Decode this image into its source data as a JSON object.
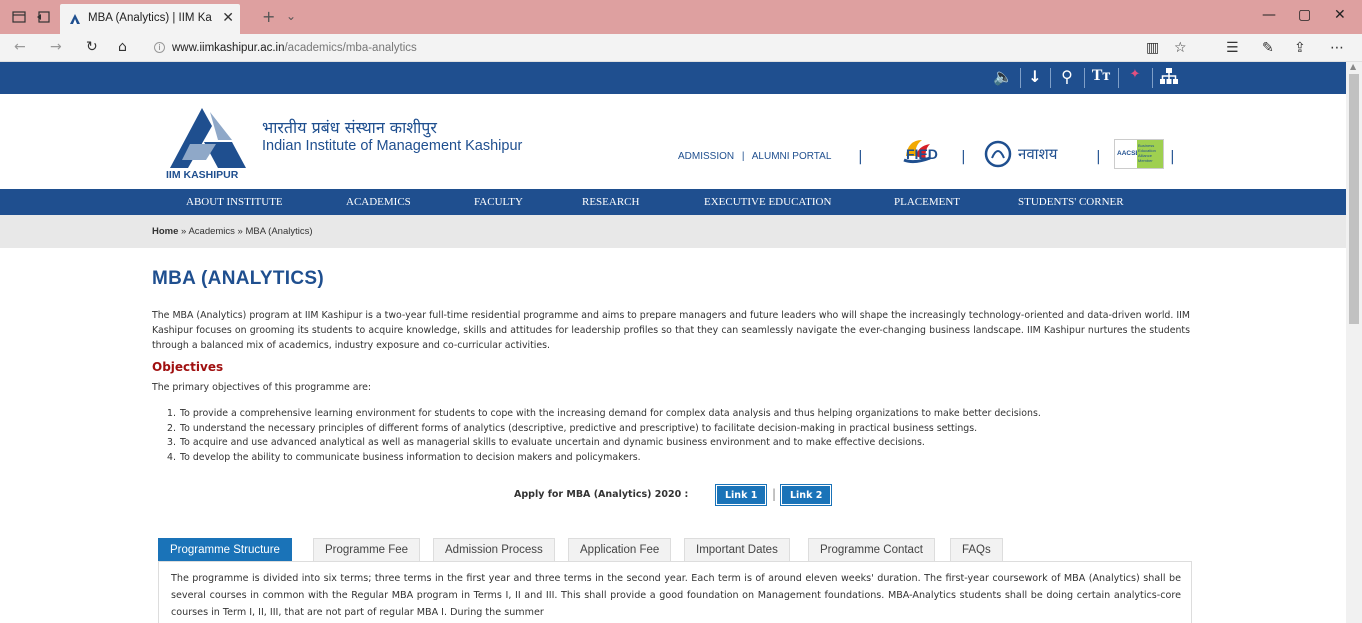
{
  "browser": {
    "tab_title": "MBA (Analytics) | IIM Ka",
    "url_domain": "www.iimkashipur.ac.in",
    "url_path": "/academics/mba-analytics"
  },
  "site": {
    "logo_text": "IIM KASHIPUR",
    "name_hindi": "भारतीय प्रबंध संस्थान काशीपुर",
    "name_english": "Indian Institute of Management Kashipur",
    "header_links": [
      "ADMISSION",
      "ALUMNI PORTAL"
    ],
    "fied_label": "FIED",
    "navodaya_label": "नवाशय",
    "aacsb_label": "AACSB",
    "aacsb_sub": "Business Education Alliance Member"
  },
  "nav": [
    "ABOUT INSTITUTE",
    "ACADEMICS",
    "FACULTY",
    "RESEARCH",
    "EXECUTIVE EDUCATION",
    "PLACEMENT",
    "STUDENTS' CORNER"
  ],
  "breadcrumb": {
    "home": "Home",
    "rest": " » Academics » MBA (Analytics)"
  },
  "page": {
    "title": "MBA (ANALYTICS)",
    "intro": "The MBA (Analytics) program at IIM Kashipur is a two-year full-time residential programme and aims to prepare managers and future leaders who will shape the increasingly technology-oriented and data-driven world. IIM Kashipur focuses on grooming its students to acquire knowledge, skills and attitudes for leadership profiles so that they can seamlessly navigate the ever-changing business landscape. IIM Kashipur nurtures the students through a balanced mix of academics, industry exposure and co-curricular activities.",
    "objectives_heading": "Objectives",
    "objectives_intro": "The primary objectives of this programme are:",
    "objectives": [
      "To provide a comprehensive learning environment for students to cope with the increasing demand for complex data analysis and thus helping organizations to make better decisions.",
      "To understand the necessary principles of different forms of analytics (descriptive, predictive and prescriptive) to facilitate decision-making in practical business settings.",
      "To acquire and use advanced analytical as well as managerial skills to evaluate uncertain and dynamic business environment and to make effective decisions.",
      "To develop the ability to communicate business information to decision makers and policymakers."
    ],
    "apply_label": "Apply for MBA (Analytics) 2020 :",
    "link1": "Link 1",
    "link2": "Link 2"
  },
  "tabs": {
    "items": [
      "Programme Structure",
      "Programme Fee",
      "Admission Process",
      "Application Fee",
      "Important Dates",
      "Programme Contact",
      "FAQs"
    ],
    "active": "Programme Structure",
    "content": "The programme is divided into six terms; three terms in the first year and three terms in the second year. Each term is of around eleven weeks' duration. The first-year coursework of MBA (Analytics) shall be several courses in common with the Regular MBA program in Terms I, II and III. This shall provide a good foundation on Management foundations. MBA-Analytics students shall be doing certain analytics-core courses in Term I, II, III, that are not part of regular MBA I. During the summer"
  },
  "colors": {
    "brand_blue": "#1f4f8f",
    "tab_active": "#1a73b8",
    "objectives_red": "#a01010",
    "titlebar": "#dea0a0"
  }
}
